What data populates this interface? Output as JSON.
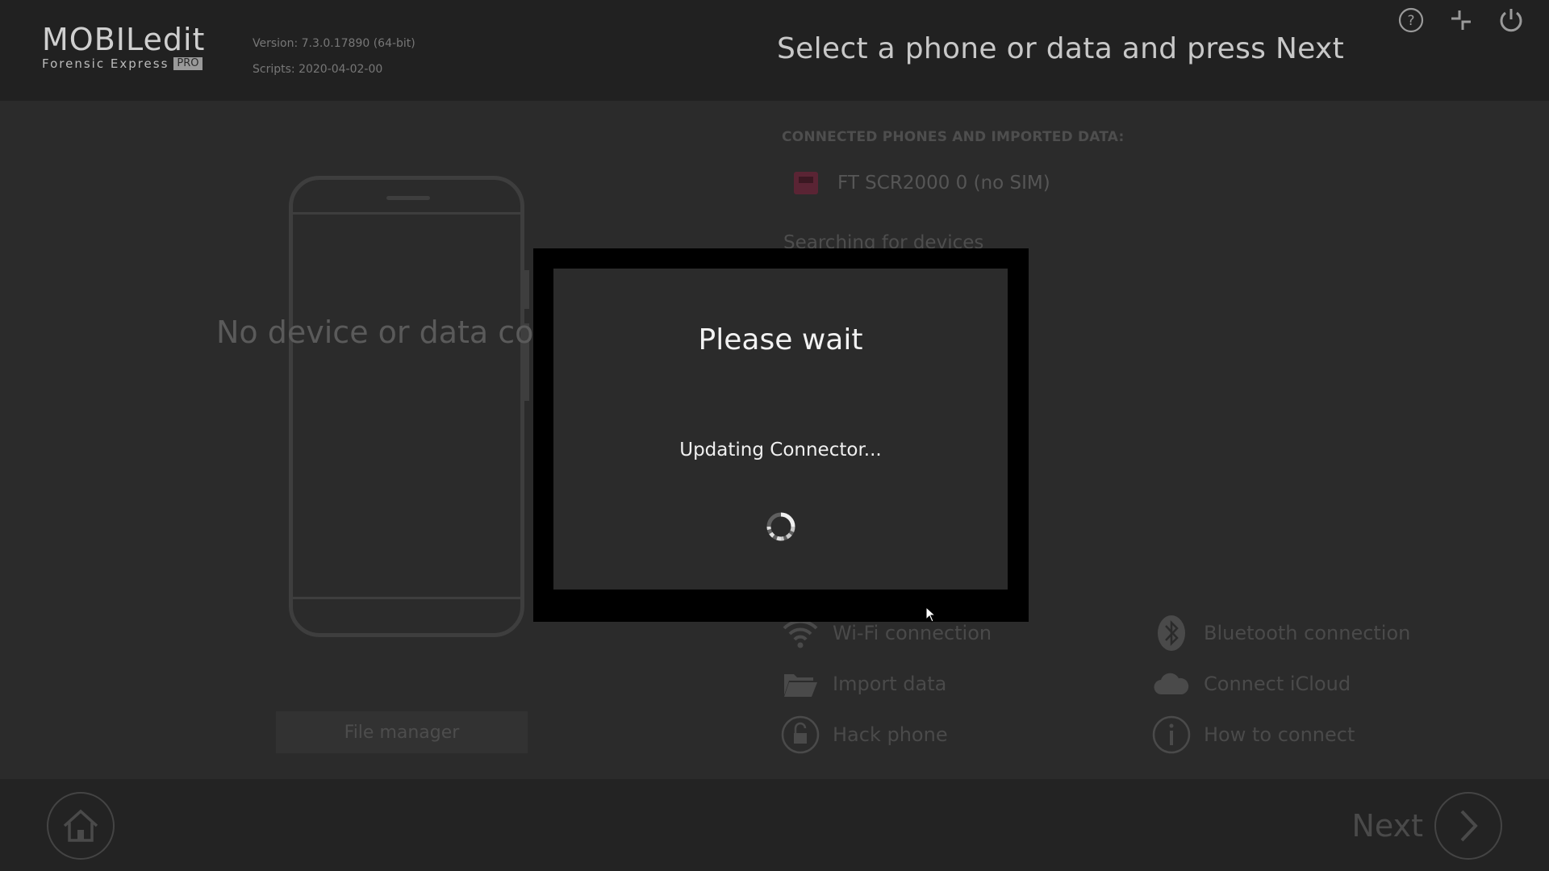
{
  "header": {
    "logo_main": "MOBILedit",
    "logo_sub": "Forensic Express",
    "logo_badge": "PRO",
    "version": "Version: 7.3.0.17890 (64-bit)",
    "scripts": "Scripts: 2020-04-02-00",
    "title": "Select a phone or data and press Next",
    "icons": [
      "help-icon",
      "compact-view-icon",
      "power-icon"
    ]
  },
  "main": {
    "no_device_text": "No device or data conne",
    "file_manager_label": "File manager",
    "section_label": "CONNECTED PHONES AND IMPORTED DATA:",
    "device_name": "FT SCR2000 0  (no SIM)",
    "searching": "Searching for devices",
    "options": {
      "wifi": "Wi-Fi connection",
      "bluetooth": "Bluetooth connection",
      "import": "Import data",
      "icloud": "Connect iCloud",
      "hack": "Hack phone",
      "how_to": "How to connect"
    }
  },
  "footer": {
    "next_label": "Next"
  },
  "modal": {
    "title": "Please wait",
    "message": "Updating Connector..."
  },
  "colors": {
    "background": "#2b2b2b",
    "header": "#212121",
    "modal_border": "#000000",
    "device_icon": "#5a2434"
  }
}
